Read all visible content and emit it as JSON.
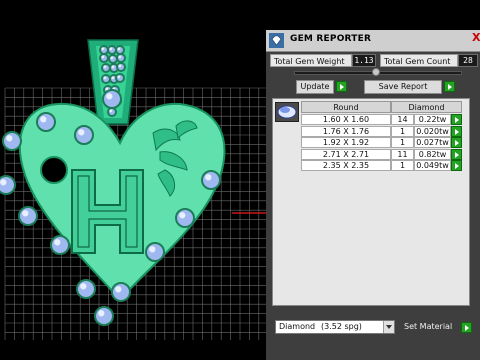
{
  "window": {
    "title": "GEM REPORTER",
    "close_glyph": "X"
  },
  "stats": {
    "weight_label": "Total Gem Weight",
    "weight_value": "1.13",
    "count_label": "Total Gem Count",
    "count_value": "28"
  },
  "buttons": {
    "update": "Update",
    "save_report": "Save Report",
    "set_material": "Set Material"
  },
  "table": {
    "headers": [
      "Round",
      "Diamond"
    ],
    "rows": [
      {
        "size": "1.60 X 1.60",
        "count": "14",
        "weight": "0.22tw"
      },
      {
        "size": "1.76 X 1.76",
        "count": "1",
        "weight": "0.020tw"
      },
      {
        "size": "1.92 X 1.92",
        "count": "1",
        "weight": "0.027tw"
      },
      {
        "size": "2.71 X 2.71",
        "count": "11",
        "weight": "0.82tw"
      },
      {
        "size": "2.35 X 2.35",
        "count": "1",
        "weight": "0.049tw"
      }
    ]
  },
  "material": {
    "name": "Diamond",
    "spg": "(3.52 spg)"
  },
  "model": {
    "letter": "H"
  },
  "colors": {
    "model": "#5fe0ad",
    "gem": "#9fb8f0",
    "accent": "#23a323",
    "panel": "#3e3e3e",
    "red_axis": "#c81818"
  },
  "icons": [
    "gem-reporter-icon",
    "close-icon",
    "play-icon",
    "dropdown-arrow-icon",
    "diamond-thumbnail-icon"
  ]
}
